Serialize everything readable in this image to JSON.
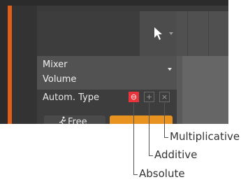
{
  "panel": {
    "parameter_line1": "Mixer",
    "parameter_line2": "Volume",
    "autom_type_label": "Autom. Type",
    "free_label": "Free"
  },
  "mode_buttons": {
    "absolute_glyph": "⊖",
    "additive_glyph": "+",
    "multiplicative_glyph": "×"
  },
  "callouts": {
    "multiplicative": "Multiplicative",
    "additive": "Additive",
    "absolute": "Absolute"
  },
  "colors": {
    "accent": "#e25d1a",
    "absolute_active": "#e8343a",
    "orange_button": "#e8931f"
  }
}
